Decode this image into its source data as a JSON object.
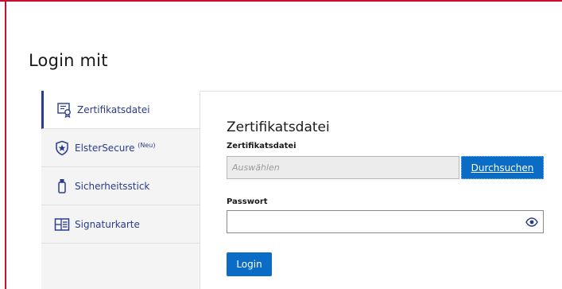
{
  "page": {
    "title": "Login mit"
  },
  "colors": {
    "accent": "#2a3c8c",
    "primary_button": "#0a6cc4",
    "frame": "#c8102e"
  },
  "sidebar": {
    "items": [
      {
        "label": "Zertifikatsdatei",
        "badge": "",
        "icon": "certificate-icon",
        "active": true
      },
      {
        "label": "ElsterSecure",
        "badge": "(Neu)",
        "icon": "shield-star-icon",
        "active": false
      },
      {
        "label": "Sicherheitsstick",
        "badge": "",
        "icon": "usb-stick-icon",
        "active": false
      },
      {
        "label": "Signaturkarte",
        "badge": "",
        "icon": "signature-card-icon",
        "active": false
      }
    ]
  },
  "form": {
    "section_title": "Zertifikatsdatei",
    "file_label": "Zertifikatsdatei",
    "file_placeholder": "Auswählen",
    "browse_label": "Durchsuchen",
    "password_label": "Passwort",
    "password_value": "",
    "login_label": "Login"
  }
}
